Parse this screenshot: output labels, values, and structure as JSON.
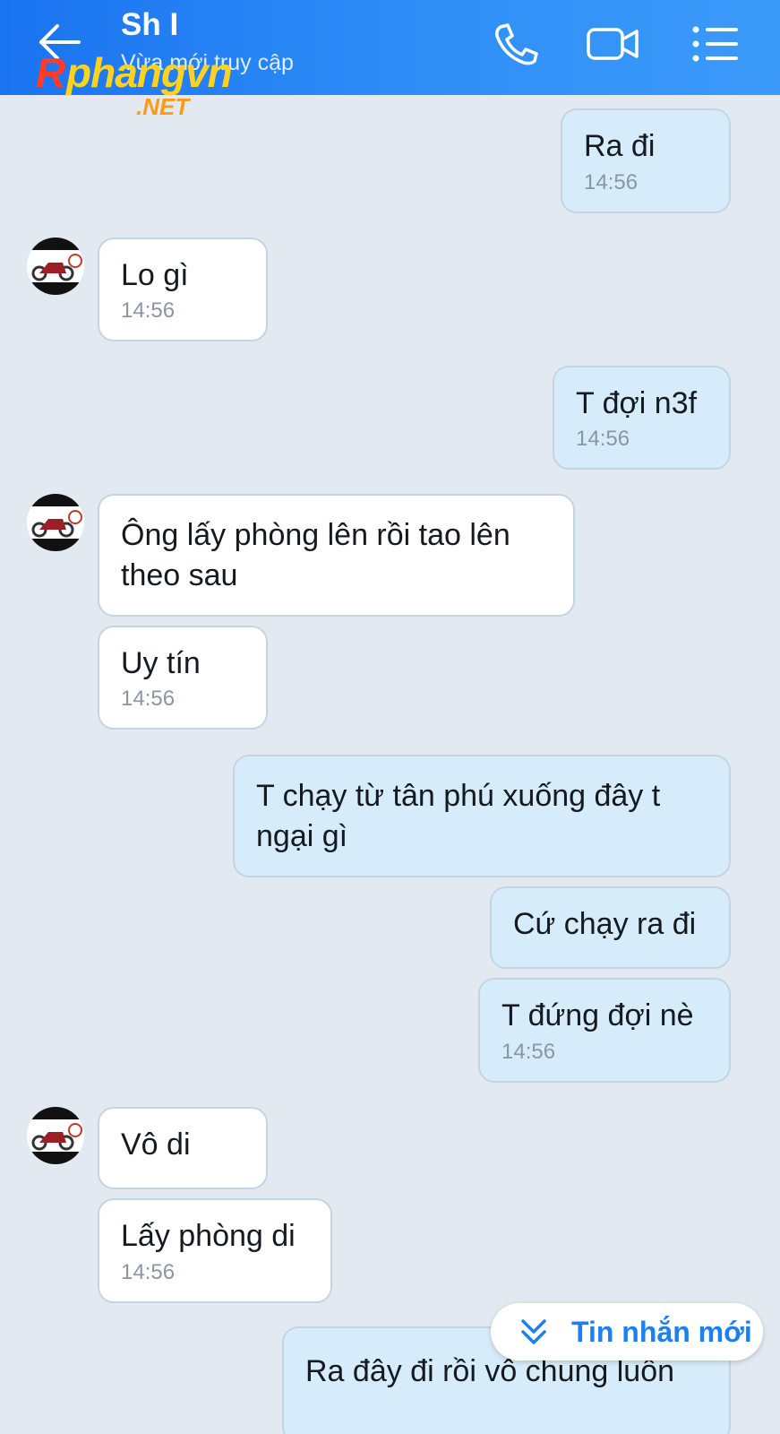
{
  "header": {
    "title": "Sh I",
    "subtitle": "Vừa mới truy cập",
    "icons": {
      "back": "arrow-left-icon",
      "call": "phone-icon",
      "video": "video-camera-icon",
      "menu": "list-menu-icon"
    }
  },
  "watermark": {
    "brand": "Rphangvn",
    "domain": ".NET"
  },
  "colors": {
    "header": "#1a73f0",
    "background": "#e2e9f1",
    "incoming": "#ffffff",
    "outgoing": "#d7ecfb",
    "accent": "#1e7ff0"
  },
  "messages": [
    {
      "side": "out",
      "text": "Ra đi",
      "time": "14:56"
    },
    {
      "side": "in",
      "text": "Lo gì",
      "time": "14:56"
    },
    {
      "side": "out",
      "text": "T đợi n3f",
      "time": "14:56"
    },
    {
      "side": "in",
      "text": "Ông lấy phòng lên rồi tao lên theo sau",
      "time": ""
    },
    {
      "side": "in",
      "text": "Uy tín",
      "time": "14:56"
    },
    {
      "side": "out",
      "text": "T chạy từ tân phú xuống đây t ngại gì",
      "time": ""
    },
    {
      "side": "out",
      "text": "Cứ chạy ra đi",
      "time": ""
    },
    {
      "side": "out",
      "text": "T đứng đợi nè",
      "time": "14:56"
    },
    {
      "side": "in",
      "text": "Vô di",
      "time": ""
    },
    {
      "side": "in",
      "text": "Lấy phòng di",
      "time": "14:56"
    },
    {
      "side": "out",
      "text": "Ra đây đi rồi vô chung luôn",
      "time": ""
    }
  ],
  "new_messages_button": {
    "label": "Tin nhắn mới",
    "icon": "double-chevron-down-icon"
  }
}
